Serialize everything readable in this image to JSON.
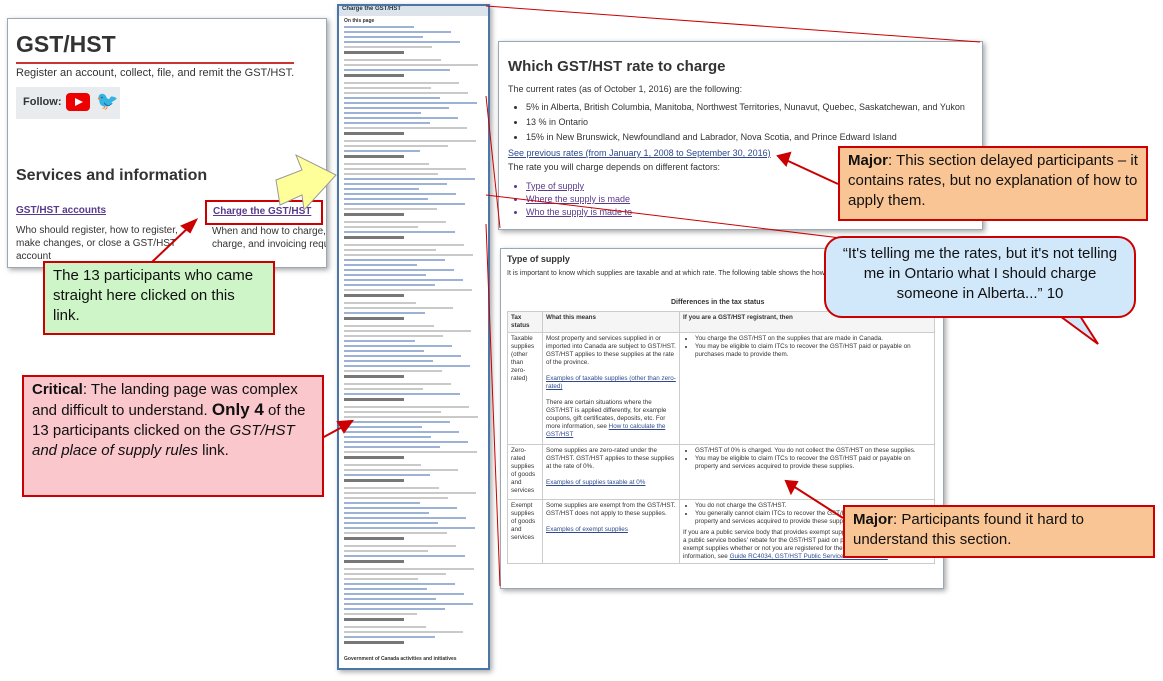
{
  "gst_panel": {
    "title": "GST/HST",
    "intro": "Register an account, collect, file, and remit the GST/HST.",
    "follow_label": "Follow:",
    "twitter_icon": "bird-icon",
    "services_heading": "Services and information",
    "link_accounts": "GST/HST accounts",
    "accounts_desc_1": "Who should register, how to register,",
    "accounts_desc_2": "make changes, or close a GST/HST",
    "accounts_desc_3": "account",
    "link_charge": "Charge the GST/HST",
    "charge_desc_1": "When and how to charge,",
    "charge_desc_2": "charge, and invoicing requ"
  },
  "long_page": {
    "header": "Charge the GST/HST",
    "section": "On this page",
    "footer": "Government of Canada activities and initiatives"
  },
  "rate_panel": {
    "heading": "Which GST/HST rate to charge",
    "intro": "The current rates (as of October 1, 2016) are the following:",
    "rates": [
      "5% in Alberta, British Columbia, Manitoba, Northwest Territories, Nunavut, Quebec, Saskatchewan, and Yukon",
      "13 % in Ontario",
      "15% in New Brunswick, Newfoundland and Labrador, Nova Scotia, and Prince Edward Island"
    ],
    "previous_rates_link": "See previous rates (from January 1, 2008 to September 30, 2016)",
    "factors_text": "The rate you will charge depends on different factors:",
    "factor_links": [
      "Type of supply",
      "Where the supply is made",
      "Who the supply is made to"
    ]
  },
  "supply_panel": {
    "heading": "Type of supply",
    "intro": "It is important to know which supplies are taxable and at which rate. The following table shows the how the GST/HST applies to them.",
    "table_caption": "Differences in the tax status",
    "headers": [
      "Tax status",
      "What this means",
      "If you are a GST/HST registrant, then"
    ],
    "rows": [
      {
        "status": "Taxable supplies (other than zero-rated)",
        "meaning": "Most property and services supplied in or imported into Canada are subject to GST/HST. GST/HST applies to these supplies at the rate of the province.",
        "meaning_link": "Examples of taxable supplies (other than zero-rated)",
        "meaning_extra": "There are certain situations where the GST/HST is applied differently, for example coupons, gift certificates, deposits, etc. For more information, see",
        "meaning_extra_link": "How to calculate the GST/HST",
        "then_1": "You charge the GST/HST on the supplies that are made in Canada.",
        "then_2": "You may be eligible to claim ITCs to recover the GST/HST paid or payable on purchases made to provide them."
      },
      {
        "status": "Zero-rated supplies of goods and services",
        "meaning": "Some supplies are zero-rated under the GST/HST. GST/HST applies to these supplies at the rate of 0%.",
        "meaning_link": "Examples of supplies taxable at 0%",
        "then_1": "GST/HST of 0% is charged. You do not collect the GST/HST on these supplies.",
        "then_2": "You may be eligible to claim ITCs to recover the GST/HST paid or payable on property and services acquired to provide these supplies."
      },
      {
        "status": "Exempt supplies of goods and services",
        "meaning": "Some supplies are exempt from the GST/HST. GST/HST does not apply to these supplies.",
        "meaning_link": "Examples of exempt supplies",
        "then_1": "You do not charge the GST/HST.",
        "then_2": "You generally cannot claim ITCs to recover the GST/HST paid or payable on property and services acquired to provide these supplies.",
        "then_extra": "If you are a public service body that provides exempt supplies, you may be able to claim a public service bodies' rebate for the GST/HST paid on purchases related to making exempt supplies whether or not you are registered for the GST/HST. For more information, see",
        "then_extra_link": "Guide RC4034, GST/HST Public Service Bodies' Rebate"
      }
    ]
  },
  "callouts": {
    "participants": "The 13 participants who came straight here clicked on this link.",
    "critical_label": "Critical",
    "critical_text": ": The landing page was complex and difficult to understand.",
    "critical_bold": "Only 4",
    "critical_mid": " of the 13 participants clicked on the ",
    "critical_italic": "GST/HST and place of supply rules",
    "critical_end": " link.",
    "major_rates_label": "Major",
    "major_rates_text": ": This section delayed participants – it contains rates, but no explanation of how to apply them.",
    "quote": "“It's telling me the rates, but it's not telling me in Ontario what I should charge someone in Alberta...” 10",
    "major_section_label": "Major",
    "major_section_text": ": Participants found it hard to understand this section."
  },
  "colors": {
    "callout_border": "#cc0000",
    "green_fill": "#cdf5c7",
    "pink_fill": "#f9c7cc",
    "orange_fill": "#f9c594",
    "blue_fill": "#d1e8fb",
    "arrow_yellow": "#ffff99"
  }
}
